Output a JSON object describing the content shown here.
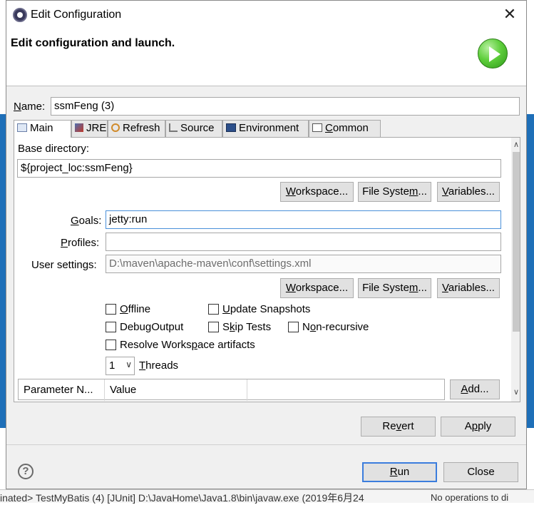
{
  "background": {
    "bottom_left_text": "inated> TestMyBatis (4) [JUnit] D:\\JavaHome\\Java1.8\\bin\\javaw.exe (2019年6月24",
    "bottom_right_text": "No operations to di"
  },
  "window": {
    "title": "Edit Configuration",
    "header_title": "Edit configuration and launch."
  },
  "name_field": {
    "label_hot": "N",
    "label_rest": "ame:",
    "value": "ssmFeng (3)"
  },
  "tabs": [
    {
      "label": "Main",
      "hot": ""
    },
    {
      "label": "JRE",
      "hot": ""
    },
    {
      "label": "Refresh",
      "hot": ""
    },
    {
      "label": "Source",
      "hot": ""
    },
    {
      "label": "Environment",
      "hot": ""
    },
    {
      "label_hot": "C",
      "label_rest": "ommon"
    }
  ],
  "main": {
    "base_dir_label": "Base directory:",
    "base_dir_value": "${project_loc:ssmFeng}",
    "btn_workspace_hot": "W",
    "btn_workspace_rest": "orkspace...",
    "btn_filesystem_a": "File Syste",
    "btn_filesystem_hot": "m",
    "btn_filesystem_b": "...",
    "btn_variables_hot": "V",
    "btn_variables_rest": "ariables...",
    "goals_label_hot": "G",
    "goals_label_rest": "oals:",
    "goals_value": "jetty:run",
    "profiles_label_hot": "P",
    "profiles_label_rest": "rofiles:",
    "profiles_value": "",
    "user_settings_label": "User settings:",
    "user_settings_value": "D:\\maven\\apache-maven\\conf\\settings.xml",
    "btn2_workspace_hot": "W",
    "btn2_workspace_rest": "orkspace...",
    "btn2_filesystem_a": "File Syste",
    "btn2_filesystem_hot": "m",
    "btn2_filesystem_b": "...",
    "btn2_variables_hot": "V",
    "btn2_variables_rest": "ariables...",
    "cb_offline_hot": "O",
    "cb_offline_rest": "ffline",
    "cb_update_hot": "U",
    "cb_update_rest": "pdate Snapshots",
    "cb_debug_a": "Debu",
    "cb_debug_hot": "g",
    "cb_debug_b": " Output",
    "cb_skiptests_a": "S",
    "cb_skiptests_hot": "k",
    "cb_skiptests_b": "ip Tests",
    "cb_nonrecursive_a": "N",
    "cb_nonrecursive_hot": "o",
    "cb_nonrecursive_b": "n-recursive",
    "cb_resolve_a": "Resolve Works",
    "cb_resolve_hot": "p",
    "cb_resolve_b": "ace artifacts",
    "threads_value": "1",
    "threads_label_hot": "T",
    "threads_label_rest": "hreads",
    "param_col1": "Parameter N...",
    "param_col2": "Value",
    "btn_add_hot": "A",
    "btn_add_rest": "dd..."
  },
  "buttons": {
    "revert_a": "Re",
    "revert_hot": "v",
    "revert_b": "ert",
    "apply_a": "A",
    "apply_hot": "p",
    "apply_b": "ply",
    "run_hot": "R",
    "run_rest": "un",
    "close": "Close"
  },
  "icons": {
    "app": "eclipse-icon",
    "run": "run-icon",
    "help": "help-icon",
    "help_glyph": "?",
    "close_glyph": "✕"
  }
}
